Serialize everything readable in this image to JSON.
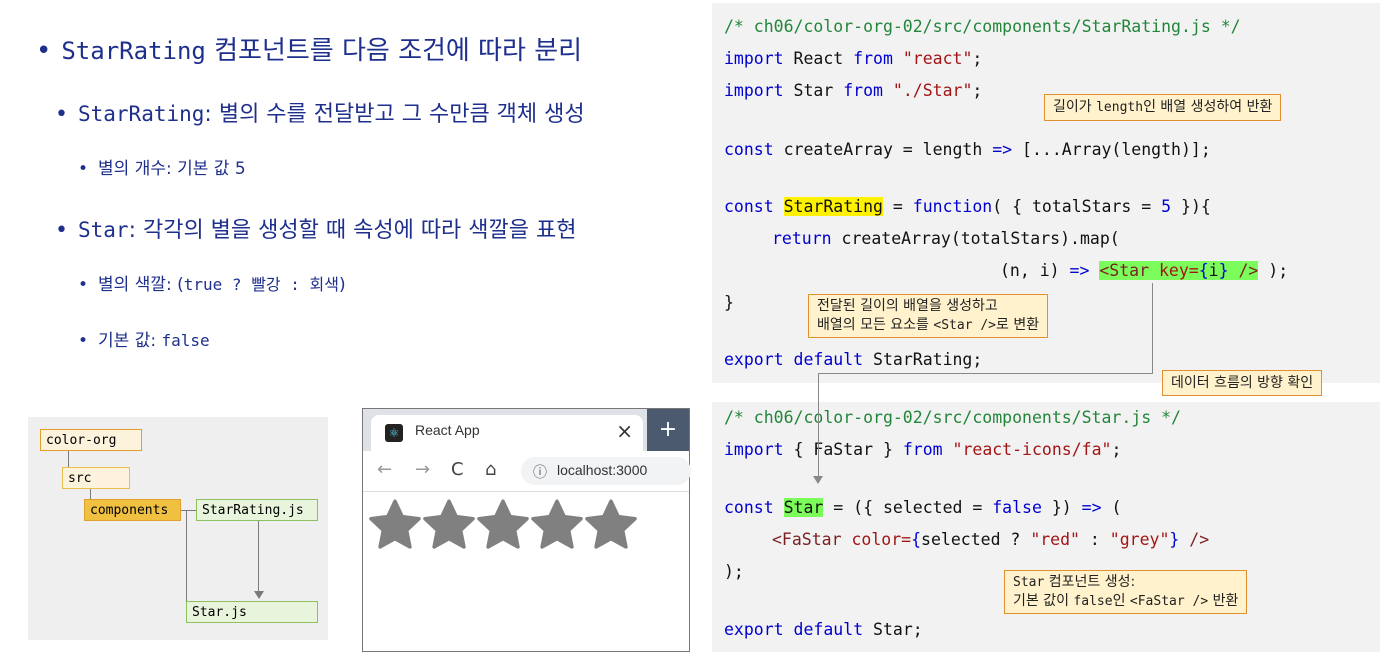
{
  "bullets": {
    "l1": {
      "code": "StarRating",
      "text": " 컴포넌트를 다음 조건에 따라 분리"
    },
    "l2a": {
      "code": "StarRating",
      "text": ": 별의 수를 전달받고 그 수만큼 객체 생성"
    },
    "l3a": {
      "text": "별의 개수: 기본 값 5"
    },
    "l2b": {
      "code": "Star",
      "text": ": 각각의 별을 생성할 때 속성에 따라 색깔을 표현"
    },
    "l3b": {
      "text_pre": "별의 색깔: (",
      "code": "true ? 빨강 : 회색",
      "text_post": ")"
    },
    "l3c": {
      "text_pre": "기본 값: ",
      "code": "false"
    }
  },
  "tree": {
    "root": "color-org",
    "src": "src",
    "components": "components",
    "star_rating": "StarRating.js",
    "star": "Star.js"
  },
  "browser": {
    "tab_title": "React App",
    "close": "×",
    "new_tab": "+",
    "back": "←",
    "forward": "→",
    "reload": "C",
    "home": "⌂",
    "info": "ⓘ",
    "url": "localhost:3000",
    "star_count": 5,
    "star_color": "#808080"
  },
  "code1": {
    "l1": "/* ch06/color-org-02/src/components/StarRating.js */",
    "l2_kw": "import",
    "l2_a": " React ",
    "l2_from": "from",
    "l2_str": " \"react\"",
    "l2_end": ";",
    "l3_kw": "import",
    "l3_a": " Star ",
    "l3_from": "from",
    "l3_str": " \"./Star\"",
    "l3_end": ";",
    "l4_kw": "const",
    "l4_a": " createArray = length ",
    "l4_arrow": "=>",
    "l4_b": " [...Array(length)];",
    "l5_kw": "const",
    "l5_sp": " ",
    "l5_hl": "StarRating",
    "l5_a": " = ",
    "l5_fn": "function",
    "l5_b": "( { totalStars = ",
    "l5_num": "5",
    "l5_c": " }){",
    "l6_kw": "return",
    "l6_a": " createArray(totalStars).map(",
    "l7_a": "(n, i) ",
    "l7_arrow": "=>",
    "l7_sp": " ",
    "l7_tag": "<Star",
    "l7_attr": " key=",
    "l7_br1": "{",
    "l7_i": "i",
    "l7_br2": "}",
    "l7_close": " />",
    "l7_end": " );",
    "l8": "}",
    "l9_kw": "export",
    "l9_sp": " ",
    "l9_def": "default",
    "l9_a": " StarRating;"
  },
  "code2": {
    "l1": "/* ch06/color-org-02/src/components/Star.js */",
    "l2_kw": "import",
    "l2_a": " { FaStar } ",
    "l2_from": "from",
    "l2_str": " \"react-icons/fa\"",
    "l2_end": ";",
    "l3_kw": "const",
    "l3_sp": " ",
    "l3_hl": "Star",
    "l3_a": " = ({ selected = ",
    "l3_false": "false",
    "l3_b": " }) ",
    "l3_arrow": "=>",
    "l3_c": " (",
    "l4_tag": "<FaStar",
    "l4_attr": " color=",
    "l4_br1": "{",
    "l4_a": "selected ? ",
    "l4_s1": "\"red\"",
    "l4_b": " : ",
    "l4_s2": "\"grey\"",
    "l4_br2": "}",
    "l4_close": " />",
    "l5": ");",
    "l6_kw": "export",
    "l6_sp": " ",
    "l6_def": "default",
    "l6_a": " Star;"
  },
  "notes": {
    "n1_pre": "길이가 ",
    "n1_code": "length",
    "n1_post": "인 배열 생성하여 반환",
    "n2_l1": "전달된 길이의 배열을 생성하고",
    "n2_l2_pre": "배열의 모든 요소를 ",
    "n2_l2_code": "<Star />",
    "n2_l2_post": "로 변환",
    "n3": "데이터 흐름의 방향 확인",
    "n4_l1_code": "Star",
    "n4_l1_post": " 컴포넌트 생성:",
    "n4_l2_pre": "기본 값이 ",
    "n4_l2_code": "false",
    "n4_l2_mid": "인 ",
    "n4_l2_code2": "<FaStar />",
    "n4_l2_post": " 반환"
  }
}
